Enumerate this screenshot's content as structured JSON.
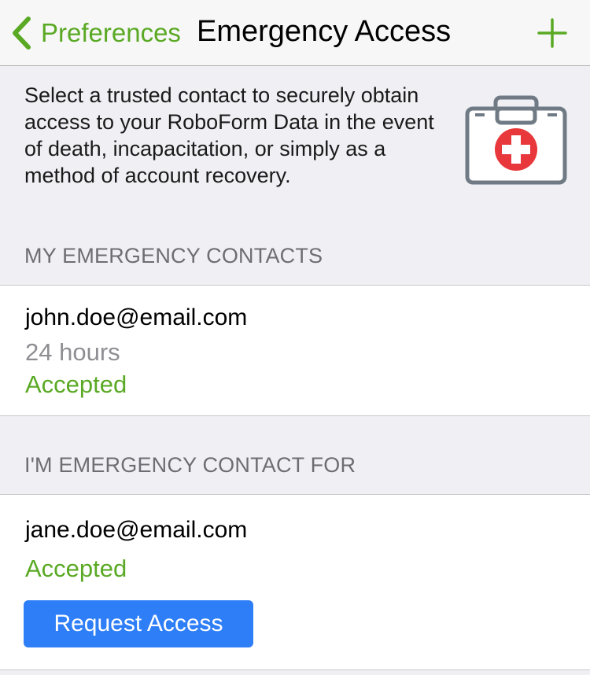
{
  "navbar": {
    "back_label": "Preferences",
    "title": "Emergency Access",
    "add_icon": "plus-icon",
    "back_icon": "chevron-left-icon"
  },
  "intro": {
    "text": "Select a trusted contact to securely obtain access to your RoboForm Data in the event of death, incapacitation, or simply as a method of account recovery.",
    "icon": "first-aid-kit-icon"
  },
  "my_contacts": {
    "header": "MY EMERGENCY CONTACTS",
    "items": [
      {
        "email": "john.doe@email.com",
        "wait_time": "24 hours",
        "status": "Accepted"
      }
    ]
  },
  "contact_for": {
    "header": "I'M EMERGENCY CONTACT FOR",
    "items": [
      {
        "email": "jane.doe@email.com",
        "status": "Accepted",
        "action_label": "Request Access"
      }
    ]
  },
  "colors": {
    "accent_green": "#5aa924",
    "button_blue": "#2d7ef7",
    "background": "#efeff4",
    "kit_red": "#e8383b",
    "kit_gray": "#6f7a84"
  }
}
